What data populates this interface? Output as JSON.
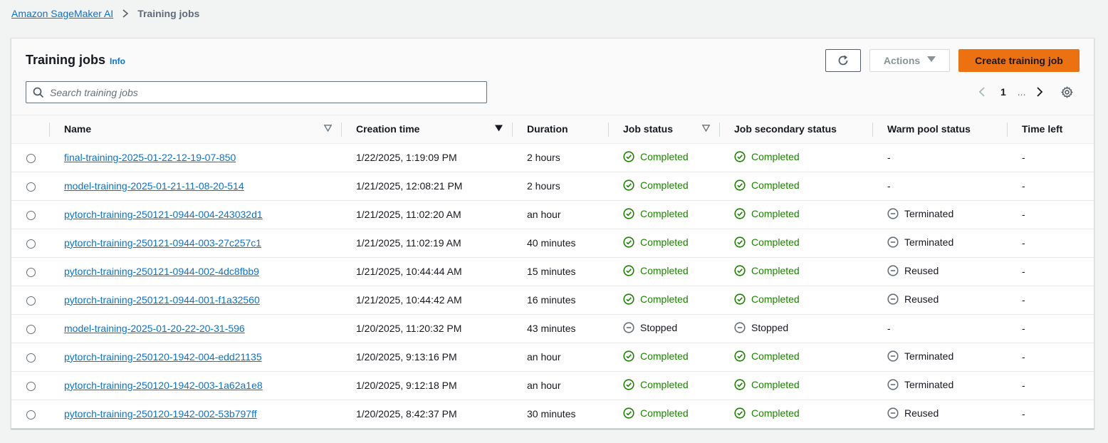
{
  "breadcrumb": {
    "root": "Amazon SageMaker AI",
    "current": "Training jobs"
  },
  "header": {
    "title": "Training jobs",
    "info": "Info",
    "actions_label": "Actions",
    "create_label": "Create training job",
    "refresh_icon": "refresh-icon"
  },
  "search": {
    "placeholder": "Search training jobs",
    "value": ""
  },
  "pagination": {
    "current_page": "1",
    "ellipsis": "..."
  },
  "columns": [
    "Name",
    "Creation time",
    "Duration",
    "Job status",
    "Job secondary status",
    "Warm pool status",
    "Time left"
  ],
  "colors": {
    "accent": "#0972d3",
    "primary_button": "#ec7211",
    "success": "#1d8102",
    "neutral": "#687078"
  },
  "rows": [
    {
      "name": "final-training-2025-01-22-12-19-07-850",
      "created": "1/22/2025, 1:19:09 PM",
      "duration": "2 hours",
      "job_status": "Completed",
      "secondary_status": "Completed",
      "warm_pool": "-",
      "time_left": "-"
    },
    {
      "name": "model-training-2025-01-21-11-08-20-514",
      "created": "1/21/2025, 12:08:21 PM",
      "duration": "2 hours",
      "job_status": "Completed",
      "secondary_status": "Completed",
      "warm_pool": "-",
      "time_left": "-"
    },
    {
      "name": "pytorch-training-250121-0944-004-243032d1",
      "created": "1/21/2025, 11:02:20 AM",
      "duration": "an hour",
      "job_status": "Completed",
      "secondary_status": "Completed",
      "warm_pool": "Terminated",
      "time_left": "-"
    },
    {
      "name": "pytorch-training-250121-0944-003-27c257c1",
      "created": "1/21/2025, 11:02:19 AM",
      "duration": "40 minutes",
      "job_status": "Completed",
      "secondary_status": "Completed",
      "warm_pool": "Terminated",
      "time_left": "-"
    },
    {
      "name": "pytorch-training-250121-0944-002-4dc8fbb9",
      "created": "1/21/2025, 10:44:44 AM",
      "duration": "15 minutes",
      "job_status": "Completed",
      "secondary_status": "Completed",
      "warm_pool": "Reused",
      "time_left": "-"
    },
    {
      "name": "pytorch-training-250121-0944-001-f1a32560",
      "created": "1/21/2025, 10:44:42 AM",
      "duration": "16 minutes",
      "job_status": "Completed",
      "secondary_status": "Completed",
      "warm_pool": "Reused",
      "time_left": "-"
    },
    {
      "name": "model-training-2025-01-20-22-20-31-596",
      "created": "1/20/2025, 11:20:32 PM",
      "duration": "43 minutes",
      "job_status": "Stopped",
      "secondary_status": "Stopped",
      "warm_pool": "-",
      "time_left": "-"
    },
    {
      "name": "pytorch-training-250120-1942-004-edd21135",
      "created": "1/20/2025, 9:13:16 PM",
      "duration": "an hour",
      "job_status": "Completed",
      "secondary_status": "Completed",
      "warm_pool": "Terminated",
      "time_left": "-"
    },
    {
      "name": "pytorch-training-250120-1942-003-1a62a1e8",
      "created": "1/20/2025, 9:12:18 PM",
      "duration": "an hour",
      "job_status": "Completed",
      "secondary_status": "Completed",
      "warm_pool": "Terminated",
      "time_left": "-"
    },
    {
      "name": "pytorch-training-250120-1942-002-53b797ff",
      "created": "1/20/2025, 8:42:37 PM",
      "duration": "30 minutes",
      "job_status": "Completed",
      "secondary_status": "Completed",
      "warm_pool": "Reused",
      "time_left": "-"
    }
  ]
}
